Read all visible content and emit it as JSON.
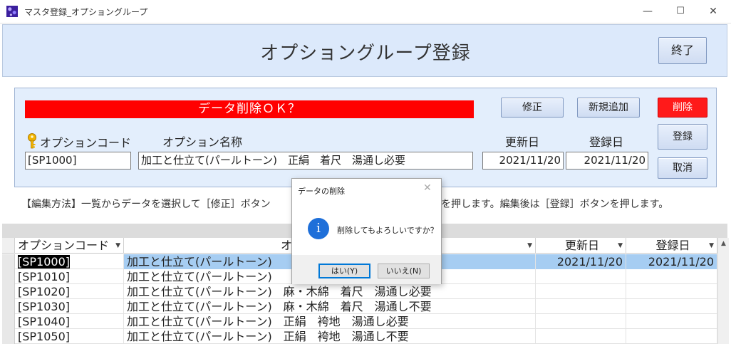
{
  "window": {
    "title": "マスタ登録_オプショングループ",
    "minimize": "—",
    "maximize": "☐",
    "close": "✕"
  },
  "header": {
    "title": "オプショングループ登録",
    "exit_label": "終了"
  },
  "form": {
    "banner": "データ削除ＯＫ？",
    "edit_label": "修正",
    "add_label": "新規追加",
    "delete_label": "削除",
    "register_label": "登録",
    "cancel_label": "取消",
    "labels": {
      "option_code": "オプションコード",
      "option_name": "オプション名称",
      "updated": "更新日",
      "registered": "登録日"
    },
    "values": {
      "option_code": "[SP1000]",
      "option_name": "加工と仕立て(パールトーン)　正絹　着尺　湯通し必要",
      "updated": "2021/11/20",
      "registered": "2021/11/20"
    }
  },
  "instructions": "【編集方法】一覧からデータを選択して［修正］ボタン",
  "instructions_tail": "を押します。編集後は［登録］ボタンを押します。",
  "grid": {
    "headers": {
      "code": "オプションコード",
      "name": "オ",
      "updated": "更新日",
      "registered": "登録日"
    },
    "rows": [
      {
        "code": "[SP1000]",
        "name": "加工と仕立て(パールトーン)",
        "updated": "2021/11/20",
        "registered": "2021/11/20"
      },
      {
        "code": "[SP1010]",
        "name": "加工と仕立て(パールトーン)",
        "updated": "",
        "registered": ""
      },
      {
        "code": "[SP1020]",
        "name": "加工と仕立て(パールトーン)　麻・木綿　着尺　湯通し必要",
        "updated": "",
        "registered": ""
      },
      {
        "code": "[SP1030]",
        "name": "加工と仕立て(パールトーン)　麻・木綿　着尺　湯通し不要",
        "updated": "",
        "registered": ""
      },
      {
        "code": "[SP1040]",
        "name": "加工と仕立て(パールトーン)　正絹　袴地　湯通し必要",
        "updated": "",
        "registered": ""
      },
      {
        "code": "[SP1050]",
        "name": "加工と仕立て(パールトーン)　正絹　袴地　湯通し不要",
        "updated": "",
        "registered": ""
      }
    ]
  },
  "dialog": {
    "title": "データの削除",
    "message": "削除してもよろしいですか？",
    "yes_label": "はい(Y)",
    "no_label": "いいえ(N)",
    "icon": "i"
  }
}
